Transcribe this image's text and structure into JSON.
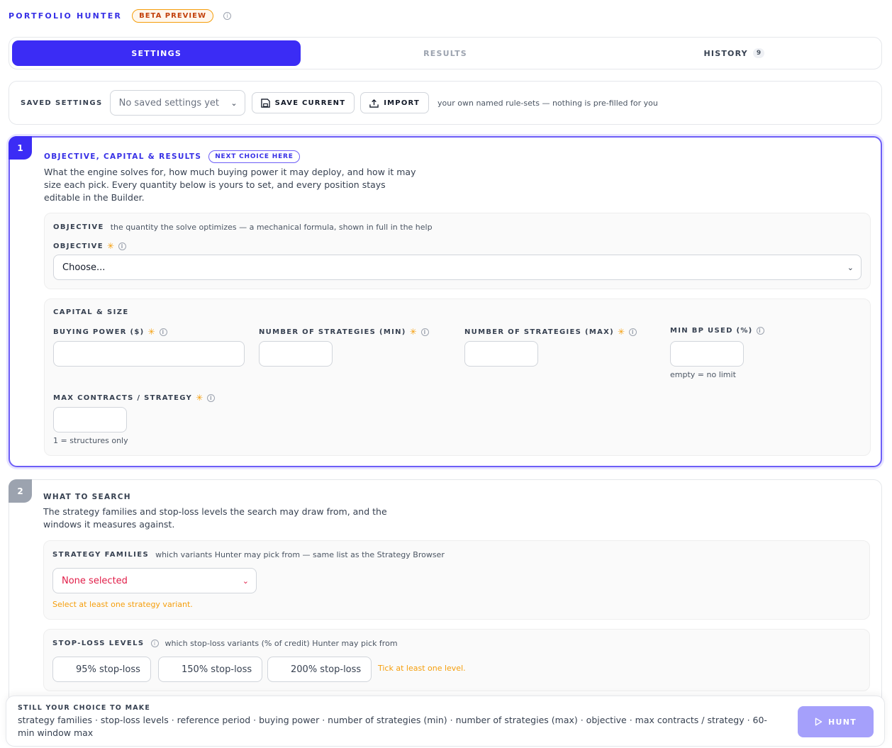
{
  "app": {
    "brand": "PORTFOLIO HUNTER",
    "badge": "BETA PREVIEW"
  },
  "tabs": [
    {
      "label": "SETTINGS",
      "active": true
    },
    {
      "label": "RESULTS",
      "active": false
    },
    {
      "label": "HISTORY",
      "count": "9",
      "active": false
    }
  ],
  "saved": {
    "label": "SAVED SETTINGS",
    "selected": "No saved settings yet",
    "save_label": "SAVE CURRENT",
    "import_label": "IMPORT",
    "hint": "your own named rule-sets — nothing is pre-filled for you"
  },
  "section1": {
    "number": "1",
    "title": "OBJECTIVE, CAPITAL & RESULTS",
    "pill": "NEXT CHOICE HERE",
    "description": "What the engine solves for, how much buying power it may deploy, and how it may size each pick. Every quantity below is yours to set, and every position stays editable in the Builder.",
    "objective_card": {
      "title": "OBJECTIVE",
      "subtitle": "the quantity the solve optimizes — a mechanical formula, shown in full in the help",
      "field_label": "OBJECTIVE",
      "select_value": "Choose..."
    },
    "capital_card": {
      "title": "CAPITAL & SIZE",
      "buying_power": "BUYING POWER ($)",
      "num_min": "NUMBER OF STRATEGIES (MIN)",
      "num_max": "NUMBER OF STRATEGIES (MAX)",
      "min_bp": "MIN BP USED (%)",
      "min_bp_note": "empty = no limit",
      "max_contracts": "MAX CONTRACTS / STRATEGY",
      "max_contracts_note": "1 = structures only"
    }
  },
  "section2": {
    "number": "2",
    "title": "WHAT TO SEARCH",
    "description": "The strategy families and stop-loss levels the search may draw from, and the windows it measures against.",
    "families_card": {
      "title": "STRATEGY FAMILIES",
      "subtitle": "which variants Hunter may pick from — same list as the Strategy Browser",
      "select_value": "None selected",
      "warning": "Select at least one strategy variant."
    },
    "stoploss_card": {
      "title": "STOP-LOSS LEVELS",
      "subtitle": "which stop-loss variants (% of credit) Hunter may pick from",
      "options": [
        "95% stop-loss",
        "150% stop-loss",
        "200% stop-loss"
      ],
      "warning": "Tick at least one level."
    }
  },
  "footer": {
    "title": "STILL YOUR CHOICE TO MAKE",
    "items": "strategy families · stop-loss levels · reference period · buying power · number of strategies (min) · number of strategies (max) · objective · max contracts / strategy · 60-min window max",
    "hunt_label": "HUNT"
  },
  "colors": {
    "accent": "#3b2cf5",
    "warning": "#f59e0b",
    "error": "#e11d48"
  }
}
